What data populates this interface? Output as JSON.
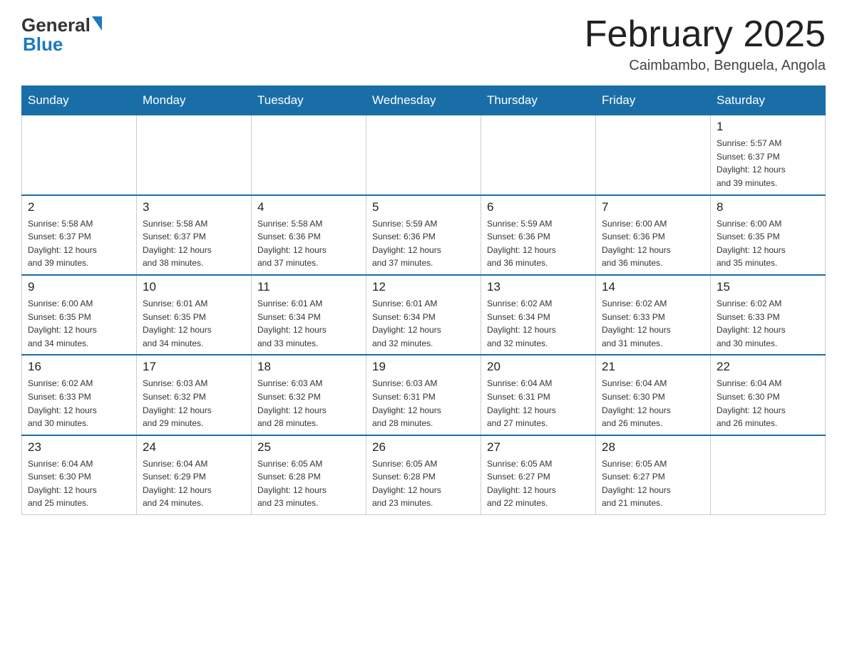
{
  "header": {
    "logo_general": "General",
    "logo_blue": "Blue",
    "month_title": "February 2025",
    "subtitle": "Caimbambo, Benguela, Angola"
  },
  "weekdays": [
    "Sunday",
    "Monday",
    "Tuesday",
    "Wednesday",
    "Thursday",
    "Friday",
    "Saturday"
  ],
  "weeks": [
    [
      {
        "day": "",
        "info": ""
      },
      {
        "day": "",
        "info": ""
      },
      {
        "day": "",
        "info": ""
      },
      {
        "day": "",
        "info": ""
      },
      {
        "day": "",
        "info": ""
      },
      {
        "day": "",
        "info": ""
      },
      {
        "day": "1",
        "info": "Sunrise: 5:57 AM\nSunset: 6:37 PM\nDaylight: 12 hours\nand 39 minutes."
      }
    ],
    [
      {
        "day": "2",
        "info": "Sunrise: 5:58 AM\nSunset: 6:37 PM\nDaylight: 12 hours\nand 39 minutes."
      },
      {
        "day": "3",
        "info": "Sunrise: 5:58 AM\nSunset: 6:37 PM\nDaylight: 12 hours\nand 38 minutes."
      },
      {
        "day": "4",
        "info": "Sunrise: 5:58 AM\nSunset: 6:36 PM\nDaylight: 12 hours\nand 37 minutes."
      },
      {
        "day": "5",
        "info": "Sunrise: 5:59 AM\nSunset: 6:36 PM\nDaylight: 12 hours\nand 37 minutes."
      },
      {
        "day": "6",
        "info": "Sunrise: 5:59 AM\nSunset: 6:36 PM\nDaylight: 12 hours\nand 36 minutes."
      },
      {
        "day": "7",
        "info": "Sunrise: 6:00 AM\nSunset: 6:36 PM\nDaylight: 12 hours\nand 36 minutes."
      },
      {
        "day": "8",
        "info": "Sunrise: 6:00 AM\nSunset: 6:35 PM\nDaylight: 12 hours\nand 35 minutes."
      }
    ],
    [
      {
        "day": "9",
        "info": "Sunrise: 6:00 AM\nSunset: 6:35 PM\nDaylight: 12 hours\nand 34 minutes."
      },
      {
        "day": "10",
        "info": "Sunrise: 6:01 AM\nSunset: 6:35 PM\nDaylight: 12 hours\nand 34 minutes."
      },
      {
        "day": "11",
        "info": "Sunrise: 6:01 AM\nSunset: 6:34 PM\nDaylight: 12 hours\nand 33 minutes."
      },
      {
        "day": "12",
        "info": "Sunrise: 6:01 AM\nSunset: 6:34 PM\nDaylight: 12 hours\nand 32 minutes."
      },
      {
        "day": "13",
        "info": "Sunrise: 6:02 AM\nSunset: 6:34 PM\nDaylight: 12 hours\nand 32 minutes."
      },
      {
        "day": "14",
        "info": "Sunrise: 6:02 AM\nSunset: 6:33 PM\nDaylight: 12 hours\nand 31 minutes."
      },
      {
        "day": "15",
        "info": "Sunrise: 6:02 AM\nSunset: 6:33 PM\nDaylight: 12 hours\nand 30 minutes."
      }
    ],
    [
      {
        "day": "16",
        "info": "Sunrise: 6:02 AM\nSunset: 6:33 PM\nDaylight: 12 hours\nand 30 minutes."
      },
      {
        "day": "17",
        "info": "Sunrise: 6:03 AM\nSunset: 6:32 PM\nDaylight: 12 hours\nand 29 minutes."
      },
      {
        "day": "18",
        "info": "Sunrise: 6:03 AM\nSunset: 6:32 PM\nDaylight: 12 hours\nand 28 minutes."
      },
      {
        "day": "19",
        "info": "Sunrise: 6:03 AM\nSunset: 6:31 PM\nDaylight: 12 hours\nand 28 minutes."
      },
      {
        "day": "20",
        "info": "Sunrise: 6:04 AM\nSunset: 6:31 PM\nDaylight: 12 hours\nand 27 minutes."
      },
      {
        "day": "21",
        "info": "Sunrise: 6:04 AM\nSunset: 6:30 PM\nDaylight: 12 hours\nand 26 minutes."
      },
      {
        "day": "22",
        "info": "Sunrise: 6:04 AM\nSunset: 6:30 PM\nDaylight: 12 hours\nand 26 minutes."
      }
    ],
    [
      {
        "day": "23",
        "info": "Sunrise: 6:04 AM\nSunset: 6:30 PM\nDaylight: 12 hours\nand 25 minutes."
      },
      {
        "day": "24",
        "info": "Sunrise: 6:04 AM\nSunset: 6:29 PM\nDaylight: 12 hours\nand 24 minutes."
      },
      {
        "day": "25",
        "info": "Sunrise: 6:05 AM\nSunset: 6:28 PM\nDaylight: 12 hours\nand 23 minutes."
      },
      {
        "day": "26",
        "info": "Sunrise: 6:05 AM\nSunset: 6:28 PM\nDaylight: 12 hours\nand 23 minutes."
      },
      {
        "day": "27",
        "info": "Sunrise: 6:05 AM\nSunset: 6:27 PM\nDaylight: 12 hours\nand 22 minutes."
      },
      {
        "day": "28",
        "info": "Sunrise: 6:05 AM\nSunset: 6:27 PM\nDaylight: 12 hours\nand 21 minutes."
      },
      {
        "day": "",
        "info": ""
      }
    ]
  ]
}
